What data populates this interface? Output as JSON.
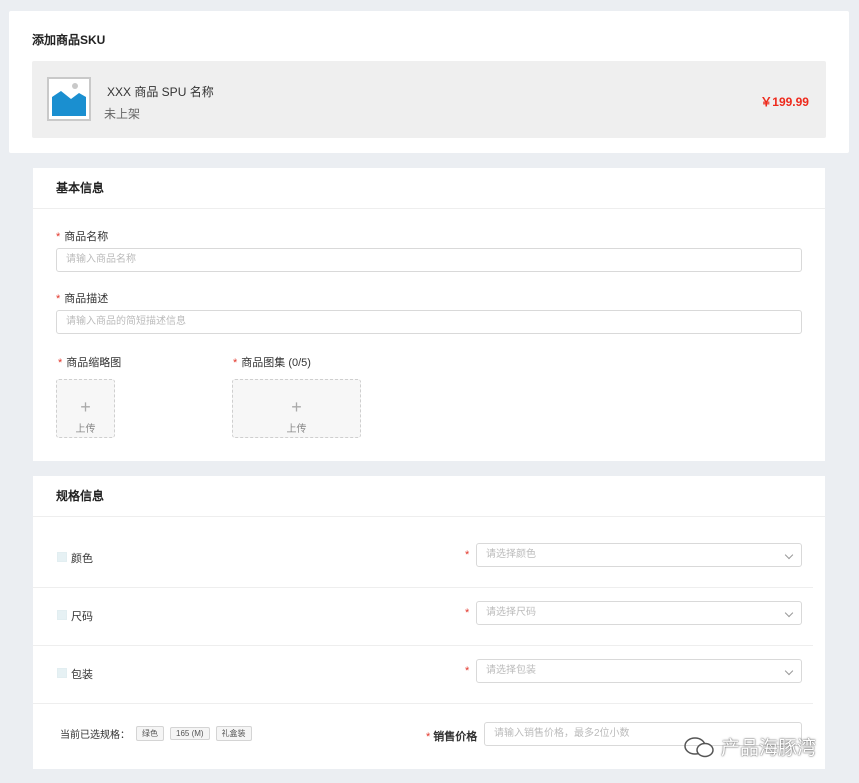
{
  "page_title": "添加商品SKU",
  "spu": {
    "name": "XXX 商品 SPU 名称",
    "status": "未上架",
    "price": "￥199.99"
  },
  "basic": {
    "title": "基本信息",
    "required_mark": "*",
    "name_label": "商品名称",
    "name_placeholder": "请输入商品名称",
    "desc_label": "商品描述",
    "desc_placeholder": "请输入商品的简短描述信息",
    "thumb_label": "商品缩略图",
    "gallery_label": "商品图集 (0/5)",
    "upload_plus": "+",
    "upload_label": "上传"
  },
  "spec": {
    "title": "规格信息",
    "rows": [
      {
        "name": "颜色",
        "placeholder": "请选择颜色"
      },
      {
        "name": "尺码",
        "placeholder": "请选择尺码"
      },
      {
        "name": "包装",
        "placeholder": "请选择包装"
      }
    ],
    "selected_label": "当前已选规格：",
    "selected_tags": [
      "绿色",
      "165 (M)",
      "礼盒装"
    ],
    "price_label": "销售价格",
    "price_placeholder": "请输入销售价格，最多2位小数"
  },
  "watermark": "产品海豚湾",
  "colors": {
    "accent_red": "#ee2a1c",
    "required_red": "#e3362a",
    "thumb_blue": "#1a8fd0"
  }
}
